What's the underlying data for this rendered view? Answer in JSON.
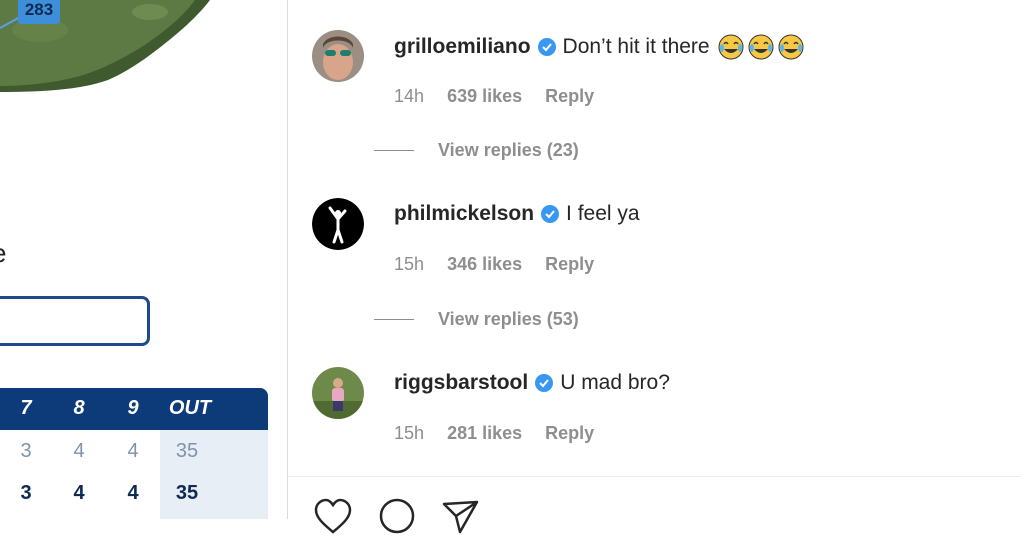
{
  "left_panel": {
    "yardage_badge": "283",
    "partial_heading": "e",
    "scorecard": {
      "holes": [
        "7",
        "8",
        "9",
        "OUT"
      ],
      "par": [
        "3",
        "4",
        "4",
        "35"
      ],
      "score": [
        "3",
        "4",
        "4",
        "35"
      ]
    }
  },
  "comments": [
    {
      "username": "grilloemiliano",
      "verified": true,
      "text": "Don’t hit it there",
      "emoji_count": 3,
      "time": "14h",
      "likes": "639 likes",
      "reply_label": "Reply",
      "view_replies": "View replies (23)"
    },
    {
      "username": "philmickelson",
      "verified": true,
      "text": "I feel ya",
      "time": "15h",
      "likes": "346 likes",
      "reply_label": "Reply",
      "view_replies": "View replies (53)"
    },
    {
      "username": "riggsbarstool",
      "verified": true,
      "text": "U mad bro?",
      "time": "15h",
      "likes": "281 likes",
      "reply_label": "Reply"
    }
  ],
  "icons": {
    "verified": "verified-badge-icon",
    "emoji": "tears-of-joy-emoji",
    "actions": [
      "heart-icon",
      "comment-icon",
      "share-icon"
    ]
  },
  "colors": {
    "verified_blue": "#3897f0",
    "meta_gray": "#8e8e8e",
    "scorecard_header": "#0d3a78"
  }
}
